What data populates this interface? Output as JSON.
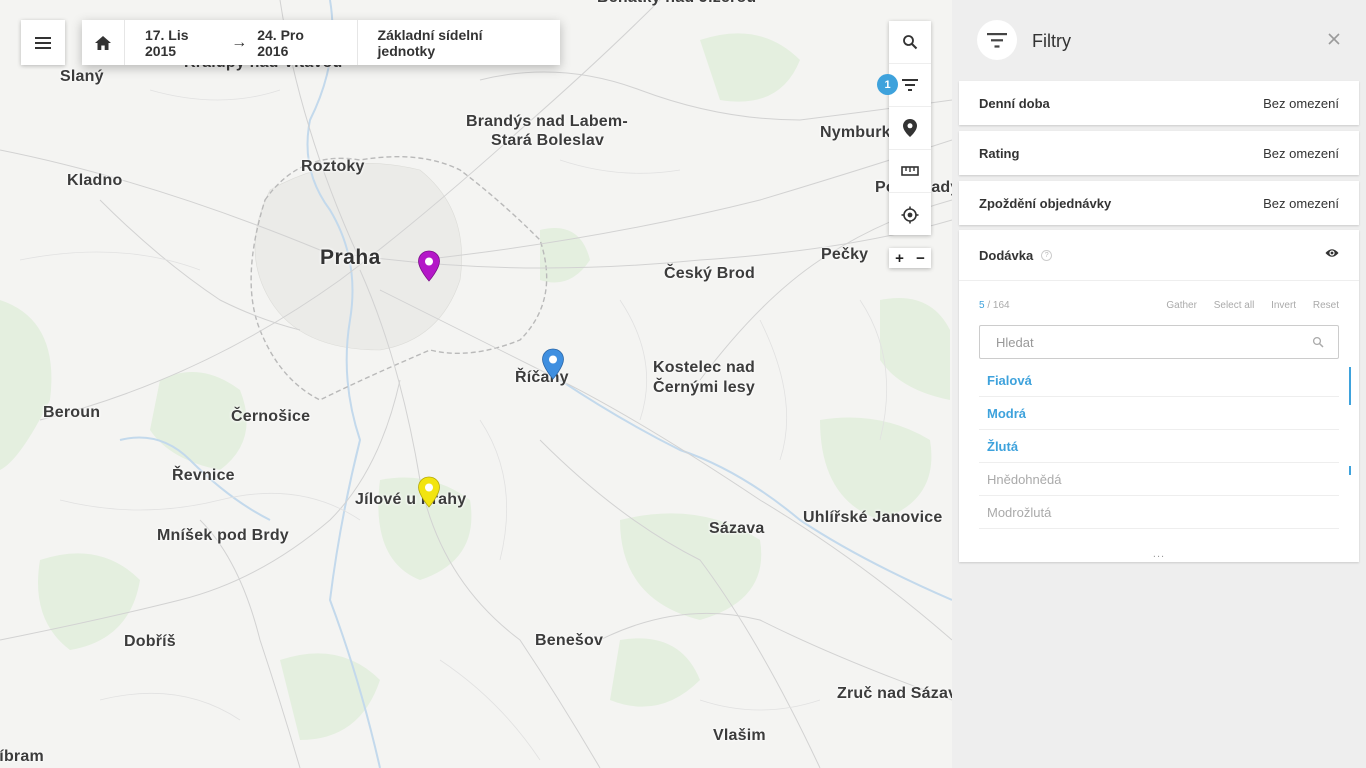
{
  "map": {
    "places": [
      {
        "id": "benatky",
        "name": "Benátky nad Jizerou"
      },
      {
        "id": "kralupy",
        "name": "Kralupy nad Vltavou"
      },
      {
        "id": "slany",
        "name": "Slaný"
      },
      {
        "id": "brandys1",
        "name": "Brandýs nad Labem-"
      },
      {
        "id": "brandys2",
        "name": "Stará Boleslav"
      },
      {
        "id": "nymburk",
        "name": "Nymburk"
      },
      {
        "id": "kladno",
        "name": "Kladno"
      },
      {
        "id": "roztoky",
        "name": "Roztoky"
      },
      {
        "id": "podebrady",
        "name": "Poděbrady"
      },
      {
        "id": "praha",
        "name": "Praha"
      },
      {
        "id": "ceskybrod",
        "name": "Český Brod"
      },
      {
        "id": "pecky",
        "name": "Pečky"
      },
      {
        "id": "ricany",
        "name": "Říčany"
      },
      {
        "id": "kostelec1",
        "name": "Kostelec nad"
      },
      {
        "id": "kostelec2",
        "name": "Černými lesy"
      },
      {
        "id": "beroun",
        "name": "Beroun"
      },
      {
        "id": "cernosice",
        "name": "Černošice"
      },
      {
        "id": "revnice",
        "name": "Řevnice"
      },
      {
        "id": "jilove",
        "name": "Jílové u Prahy"
      },
      {
        "id": "mnisek",
        "name": "Mníšek pod Brdy"
      },
      {
        "id": "sazava",
        "name": "Sázava"
      },
      {
        "id": "uhlirske",
        "name": "Uhlířské Janovice"
      },
      {
        "id": "dobris",
        "name": "Dobříš"
      },
      {
        "id": "benesov",
        "name": "Benešov"
      },
      {
        "id": "zruc",
        "name": "Zruč nad Sázavou"
      },
      {
        "id": "vlasim",
        "name": "Vlašim"
      },
      {
        "id": "pribram",
        "name": "Příbram"
      }
    ],
    "pins": [
      {
        "name": "Fialová",
        "color": "#b418c8"
      },
      {
        "name": "Modrá",
        "color": "#3f8fe0"
      },
      {
        "name": "Žlutá",
        "color": "#f2e40f"
      }
    ],
    "badge_count": "1",
    "zoom_in": "+",
    "zoom_out": "−"
  },
  "topbar": {
    "date_from": "17. Lis 2015",
    "arrow": "→",
    "date_to": "24. Pro 2016",
    "units": "Základní sídelní jednotky"
  },
  "panel": {
    "title": "Filtry",
    "filters": [
      {
        "label": "Denní doba",
        "value": "Bez omezení"
      },
      {
        "label": "Rating",
        "value": "Bez omezení"
      },
      {
        "label": "Zpoždění objednávky",
        "value": "Bez omezení"
      }
    ],
    "card": {
      "title": "Dodávka",
      "help": "?",
      "selected": "5",
      "total": "/ 164",
      "actions": [
        "Gather",
        "Select all",
        "Invert",
        "Reset"
      ],
      "search_placeholder": "Hledat",
      "items": [
        {
          "label": "Fialová",
          "selected": true
        },
        {
          "label": "Modrá",
          "selected": true
        },
        {
          "label": "Žlutá",
          "selected": true
        },
        {
          "label": "Hnědohnědá",
          "selected": false
        },
        {
          "label": "Modrožlutá",
          "selected": false
        }
      ],
      "more": "..."
    }
  },
  "colors": {
    "accent": "#3ea2dc",
    "panel_bg": "#eeeeee",
    "map_bg": "#f4f4f2"
  }
}
